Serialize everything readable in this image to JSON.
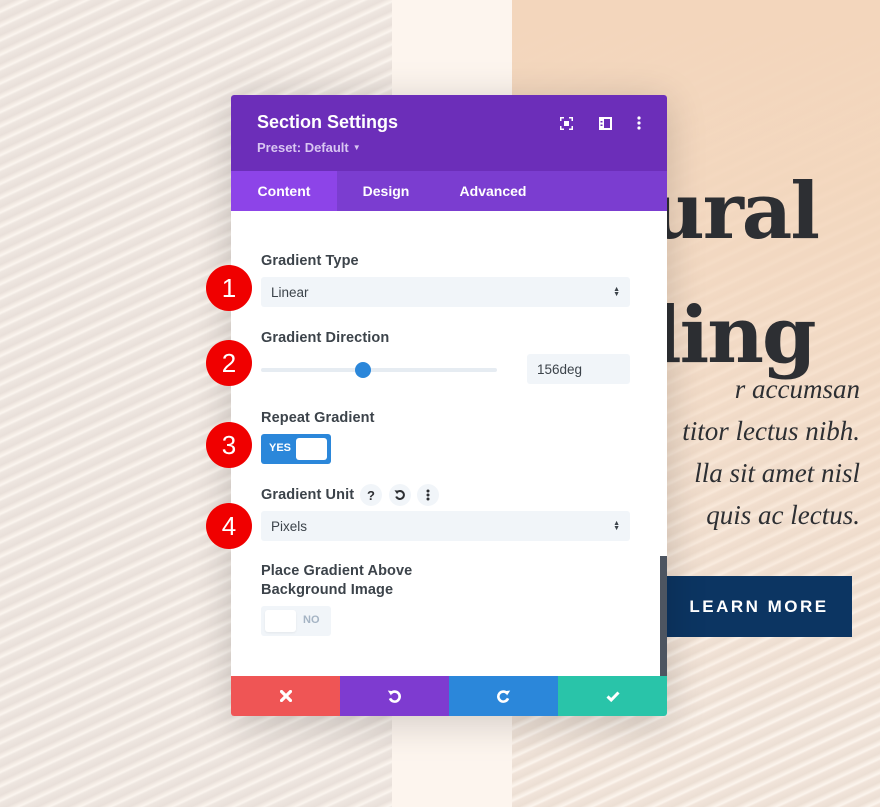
{
  "background": {
    "hero_title_lines": [
      "ural",
      "ling"
    ],
    "hero_body_lines": [
      "r accumsan",
      "titor lectus nibh.",
      "lla sit amet nisl",
      "quis ac lectus."
    ],
    "cta_label": "LEARN MORE"
  },
  "modal": {
    "title": "Section Settings",
    "preset": "Preset: Default",
    "header_icons": [
      "fullscreen-icon",
      "split-view-icon",
      "more-options-icon"
    ],
    "tabs": [
      {
        "label": "Content",
        "active": true
      },
      {
        "label": "Design",
        "active": false
      },
      {
        "label": "Advanced",
        "active": false
      }
    ],
    "fields": {
      "gradient_type": {
        "label": "Gradient Type",
        "value": "Linear"
      },
      "gradient_direction": {
        "label": "Gradient Direction",
        "value": "156deg",
        "slider_fraction": 0.433
      },
      "repeat_gradient": {
        "label": "Repeat Gradient",
        "state": "YES"
      },
      "gradient_unit": {
        "label": "Gradient Unit",
        "value": "Pixels",
        "help_icon": "?"
      },
      "place_above": {
        "label_line1": "Place Gradient Above",
        "label_line2": "Background Image",
        "state": "NO"
      }
    },
    "footer": {
      "cancel_color": "#ef5555",
      "undo_color": "#7e3bd0",
      "redo_color": "#2b87da",
      "save_color": "#29c4a9"
    }
  },
  "annotations": [
    "1",
    "2",
    "3",
    "4"
  ],
  "colors": {
    "header": "#6c2eb9",
    "tabs": "#7b3dd0",
    "active_tab": "#8d44e8",
    "accent_blue": "#2b87da",
    "badge_red": "#f00000",
    "cta": "#0c3562"
  }
}
